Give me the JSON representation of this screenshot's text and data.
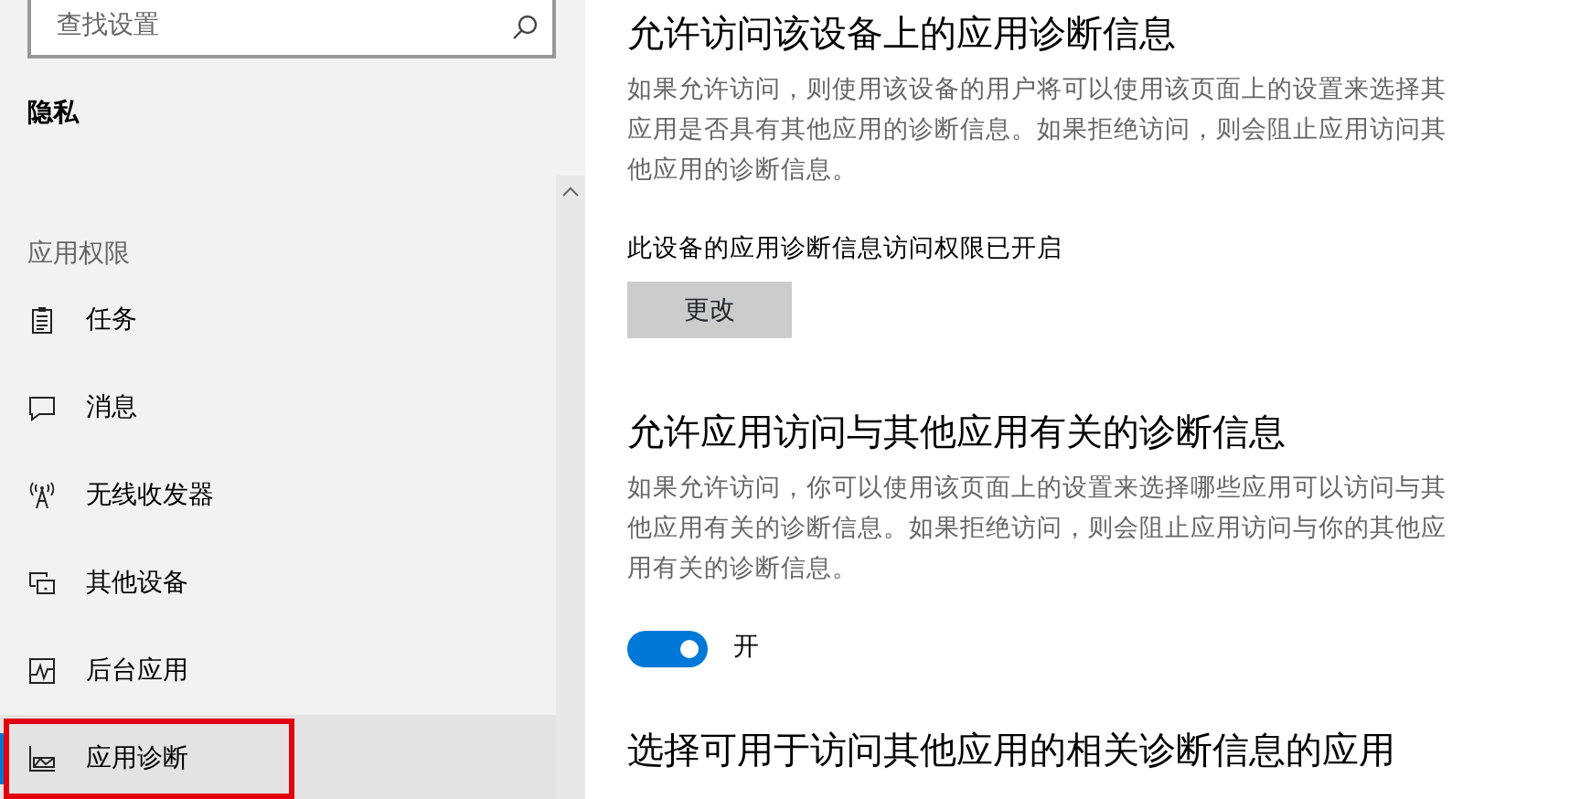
{
  "sidebar": {
    "search": {
      "placeholder": "查找设置"
    },
    "title": "隐私",
    "section": "应用权限",
    "items": [
      {
        "label": "任务",
        "selected": false,
        "highlighted": false
      },
      {
        "label": "消息",
        "selected": false,
        "highlighted": false
      },
      {
        "label": "无线收发器",
        "selected": false,
        "highlighted": false
      },
      {
        "label": "其他设备",
        "selected": false,
        "highlighted": false
      },
      {
        "label": "后台应用",
        "selected": false,
        "highlighted": false
      },
      {
        "label": "应用诊断",
        "selected": true,
        "highlighted": true
      }
    ]
  },
  "content": {
    "sections": [
      {
        "kind": "button",
        "heading": "允许访问该设备上的应用诊断信息",
        "description": "如果允许访问，则使用该设备的用户将可以使用该页面上的设置来选择其应用是否具有其他应用的诊断信息。如果拒绝访问，则会阻止应用访问其他应用的诊断信息。",
        "status": "此设备的应用诊断信息访问权限已开启",
        "button": "更改"
      },
      {
        "kind": "toggle",
        "heading": "允许应用访问与其他应用有关的诊断信息",
        "description": "如果允许访问，你可以使用该页面上的设置来选择哪些应用可以访问与其他应用有关的诊断信息。如果拒绝访问，则会阻止应用访问与你的其他应用有关的诊断信息。",
        "on": true,
        "toggle_label": "开"
      },
      {
        "kind": "heading",
        "heading": "选择可用于访问其他应用的相关诊断信息的应用"
      }
    ]
  }
}
